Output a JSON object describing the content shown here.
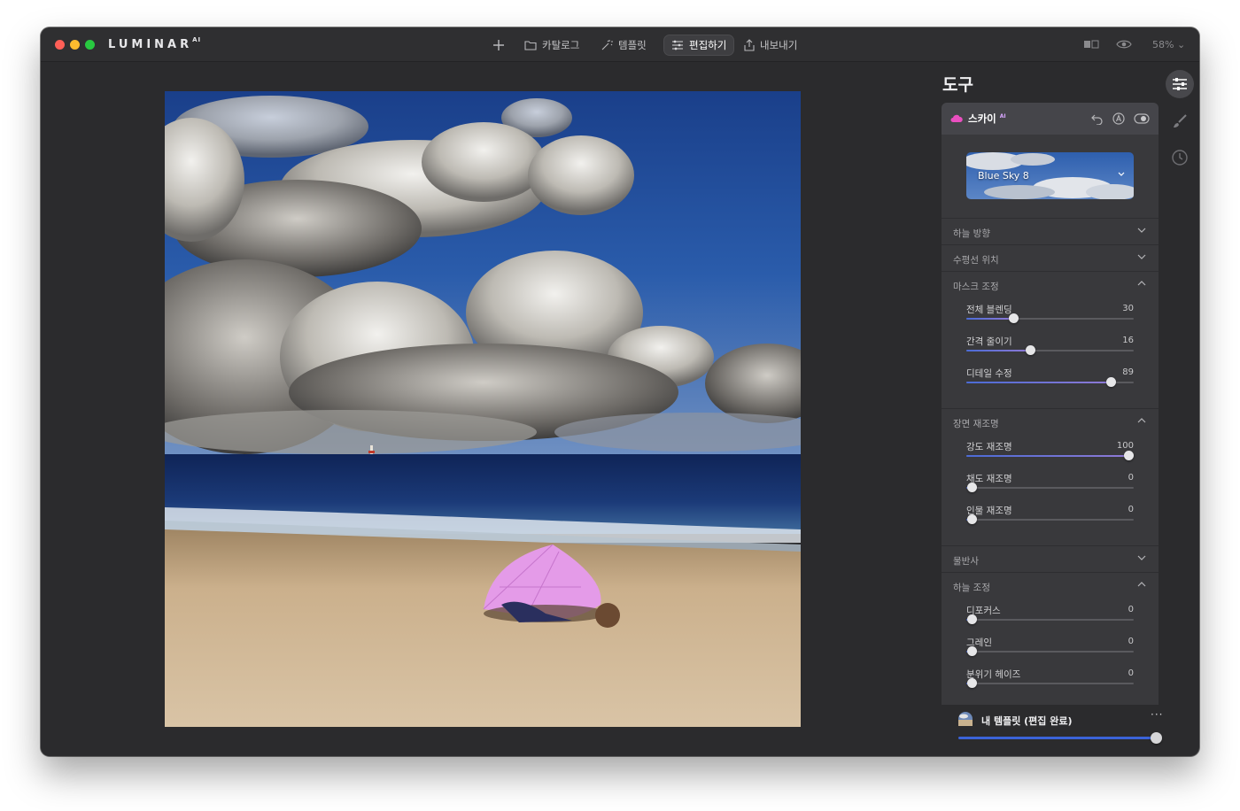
{
  "app": {
    "name": "LUMINAR",
    "name_sup": "AI"
  },
  "nav": {
    "catalog": "카탈로그",
    "templates": "템플릿",
    "edit": "편집하기",
    "export": "내보내기",
    "active": "편집하기"
  },
  "view": {
    "zoom": "58%"
  },
  "panel": {
    "title": "도구",
    "tool": {
      "name": "스카이",
      "name_sup": "AI"
    },
    "sky": {
      "selected": "Blue Sky 8"
    },
    "sections": {
      "sky_direction": "하늘 방향",
      "horizon": "수평선 위치",
      "mask": "마스크 조정",
      "relight": "장면 재조명",
      "reflection": "물반사",
      "sky_adjust": "하늘 조정"
    },
    "sliders": {
      "blend": {
        "label": "전체 블렌딩",
        "value": 30,
        "frac": 0.28
      },
      "gap": {
        "label": "간격 줄이기",
        "value": 16,
        "frac": 0.38
      },
      "detail": {
        "label": "디테일 수정",
        "value": 89,
        "frac": 0.86
      },
      "relight_strength": {
        "label": "강도 재조명",
        "value": 100,
        "frac": 0.97
      },
      "relight_sat": {
        "label": "채도 재조명",
        "value": 0,
        "frac": 0.03
      },
      "relight_person": {
        "label": "인물 재조명",
        "value": 0,
        "frac": 0.03
      },
      "defocus": {
        "label": "디포커스",
        "value": 0,
        "frac": 0.03
      },
      "grain": {
        "label": "그레인",
        "value": 0,
        "frac": 0.03
      },
      "haze": {
        "label": "분위기 헤이즈",
        "value": 0,
        "frac": 0.03
      }
    }
  },
  "template": {
    "label": "내 템플릿 (편집 완료)",
    "more": "···",
    "amount": 1.0
  },
  "colors": {
    "accent": "#3b63d8",
    "window_bg": "#2b2b2d",
    "panel_bg": "#39393c"
  }
}
